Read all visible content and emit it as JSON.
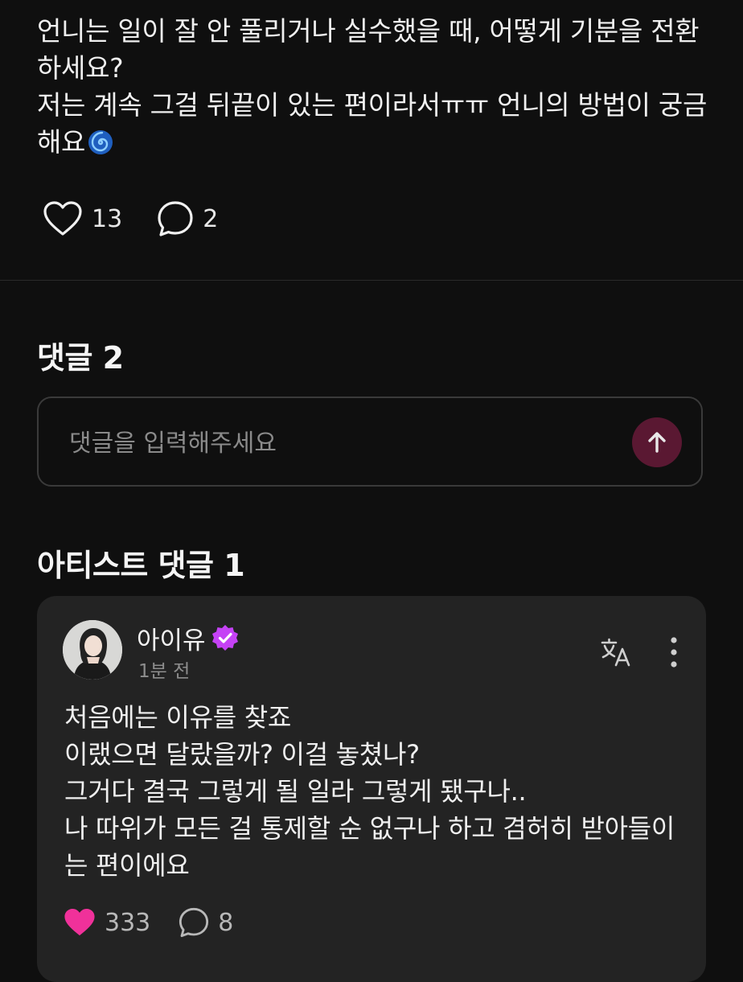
{
  "post": {
    "lines": [
      "언니는 일이 잘 안 풀리거나 실수했을 때, 어떻게 기분을 전환",
      "하세요?",
      "저는 계속 그걸 뒤끝이 있는 편이라서ㅠㅠ 언니의 방법이 궁금",
      "해요"
    ],
    "emoji": "cyclone-emoji",
    "like_count": "13",
    "comment_count": "2"
  },
  "comments_section": {
    "title": "댓글 2",
    "input_placeholder": "댓글을 입력해주세요",
    "send_icon": "arrow-up-icon"
  },
  "artist_section": {
    "title": "아티스트 댓글 1",
    "comment": {
      "author": "아이유",
      "verified_icon": "verified-badge-icon",
      "time": "1분 전",
      "lines": [
        "처음에는 이유를 찾죠",
        "이랬으면 달랐을까? 이걸 놓쳤나?",
        "그거다 결국 그렇게 될 일라 그렇게 됐구나..",
        "나 따위가 모든 걸 통제할 순 없구나 하고 겸허히 받아들이",
        "는 편이에요"
      ],
      "like_count": "333",
      "reply_count": "8",
      "liked": true
    }
  },
  "colors": {
    "background": "#0f0f0f",
    "card": "#232323",
    "accent_pink": "#f0319a",
    "verified_purple": "#c542f5",
    "send_button": "#5a1832"
  }
}
